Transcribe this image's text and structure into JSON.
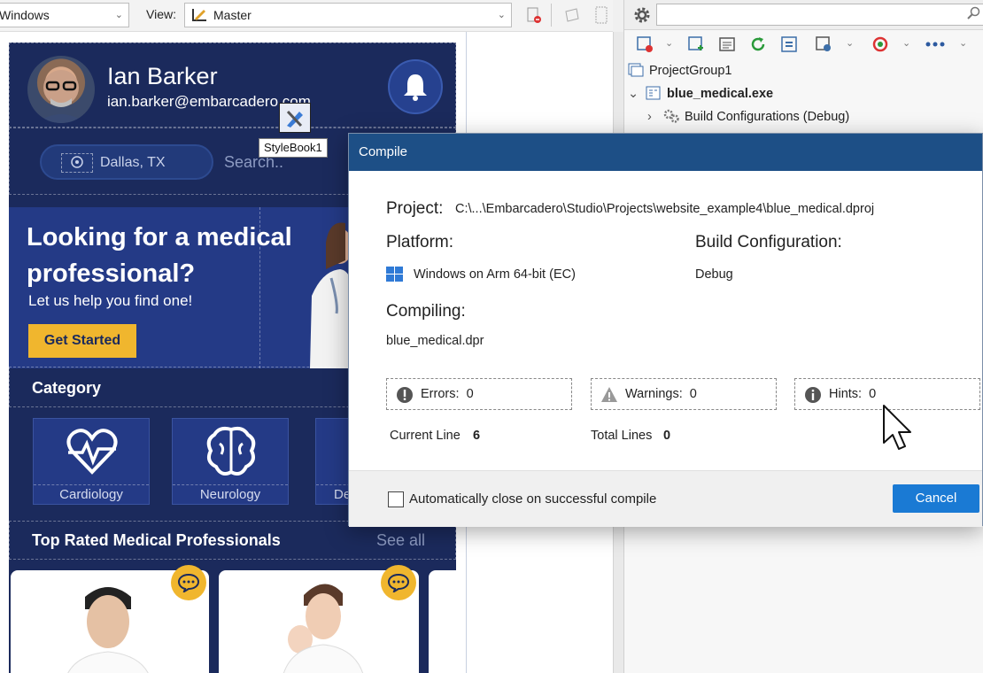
{
  "toolbar": {
    "platform_value": "Windows",
    "view_label": "View:",
    "view_value": "Master"
  },
  "tool_palette": {
    "search_placeholder": "",
    "tree": [
      {
        "label": "ProjectGroup1"
      },
      {
        "label": "blue_medical.exe"
      },
      {
        "label": "Build Configurations (Debug)"
      }
    ]
  },
  "form": {
    "user_name": "Ian Barker",
    "user_email": "ian.barker@embarcadero.com",
    "location": "Dallas, TX",
    "search_placeholder": "Search..",
    "stylebook_tooltip": "StyleBook1",
    "hero_title": "Looking for a medical professional?",
    "hero_subtitle": "Let us help you find one!",
    "get_started": "Get Started",
    "category_title": "Category",
    "categories": [
      {
        "label": "Cardiology"
      },
      {
        "label": "Neurology"
      },
      {
        "label": "De"
      }
    ],
    "top_rated_title": "Top Rated Medical Professionals",
    "see_all": "See all"
  },
  "dialog": {
    "title": "Compile",
    "project_label": "Project:",
    "project_path": "C:\\...\\Embarcadero\\Studio\\Projects\\website_example4\\blue_medical.dproj",
    "platform_label": "Platform:",
    "platform_value": "Windows on Arm 64-bit (EC)",
    "build_config_label": "Build Configuration:",
    "build_config_value": "Debug",
    "compiling_label": "Compiling:",
    "compiling_file": "blue_medical.dpr",
    "errors_label": "Errors:",
    "errors_value": "0",
    "warnings_label": "Warnings:",
    "warnings_value": "0",
    "hints_label": "Hints:",
    "hints_value": "0",
    "current_line_label": "Current Line",
    "current_line_value": "6",
    "total_lines_label": "Total Lines",
    "total_lines_value": "0",
    "auto_close_label": "Automatically close on successful compile",
    "cancel_label": "Cancel"
  },
  "colors": {
    "form_bg": "#1b2a5c",
    "accent_yellow": "#f0b62e",
    "dialog_title": "#1d4f86",
    "cancel_blue": "#1a7ad4"
  }
}
